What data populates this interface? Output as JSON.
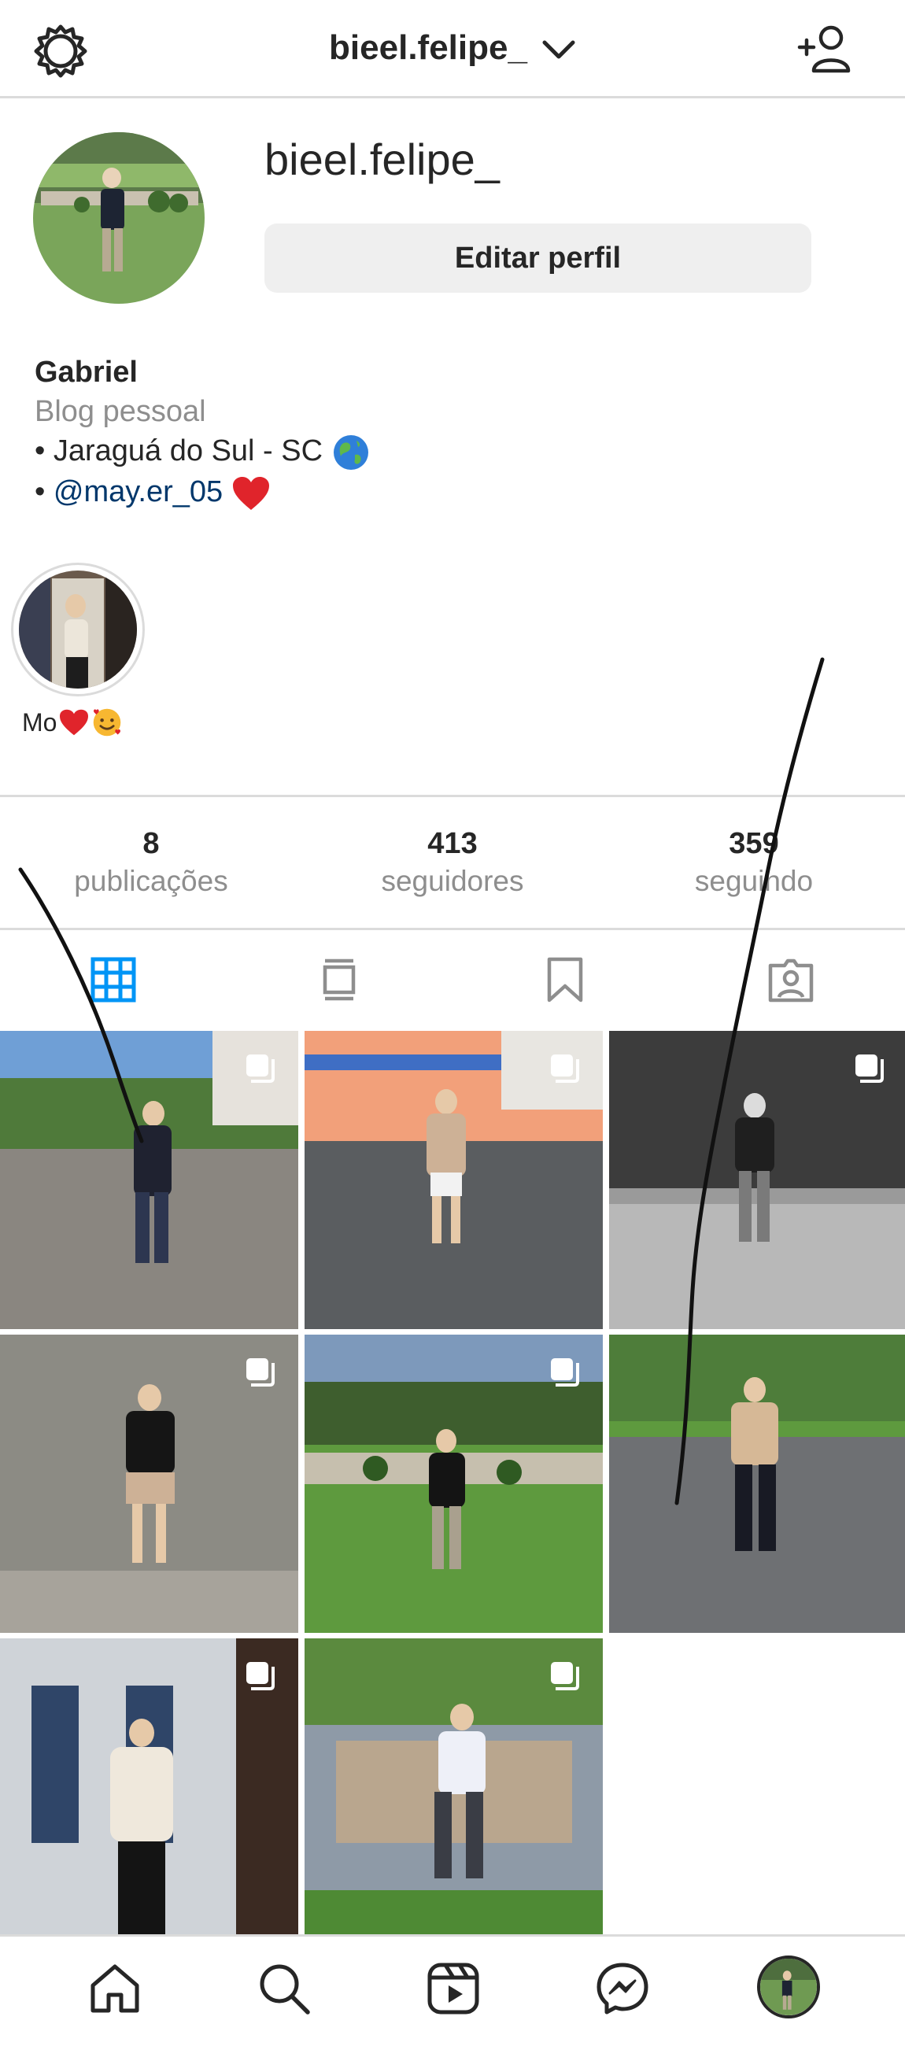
{
  "header": {
    "username": "bieel.felipe_"
  },
  "profile": {
    "name": "bieel.felipe_",
    "edit_button": "Editar perfil",
    "bio_name": "Gabriel",
    "bio_category": "Blog pessoal",
    "bio_line1": "• Jaraguá do Sul - SC",
    "bio_line2_prefix": "•",
    "bio_link": "@may.er_05"
  },
  "highlight": {
    "label": "Mo"
  },
  "stats": [
    {
      "value": "8",
      "label": "publicações"
    },
    {
      "value": "413",
      "label": "seguidores"
    },
    {
      "value": "359",
      "label": "seguindo"
    }
  ],
  "colors": {
    "link": "#00376b",
    "grid_active": "#0095f6",
    "muted": "#8e8e8e"
  },
  "icons": {
    "top": [
      "settings-icon",
      "chevron-down-icon",
      "add-user-icon"
    ],
    "tabs": [
      "grid-icon",
      "feed-icon",
      "bookmark-icon",
      "tagged-icon"
    ],
    "nav": [
      "home-icon",
      "search-icon",
      "reels-icon",
      "messenger-icon",
      "profile-avatar"
    ]
  }
}
